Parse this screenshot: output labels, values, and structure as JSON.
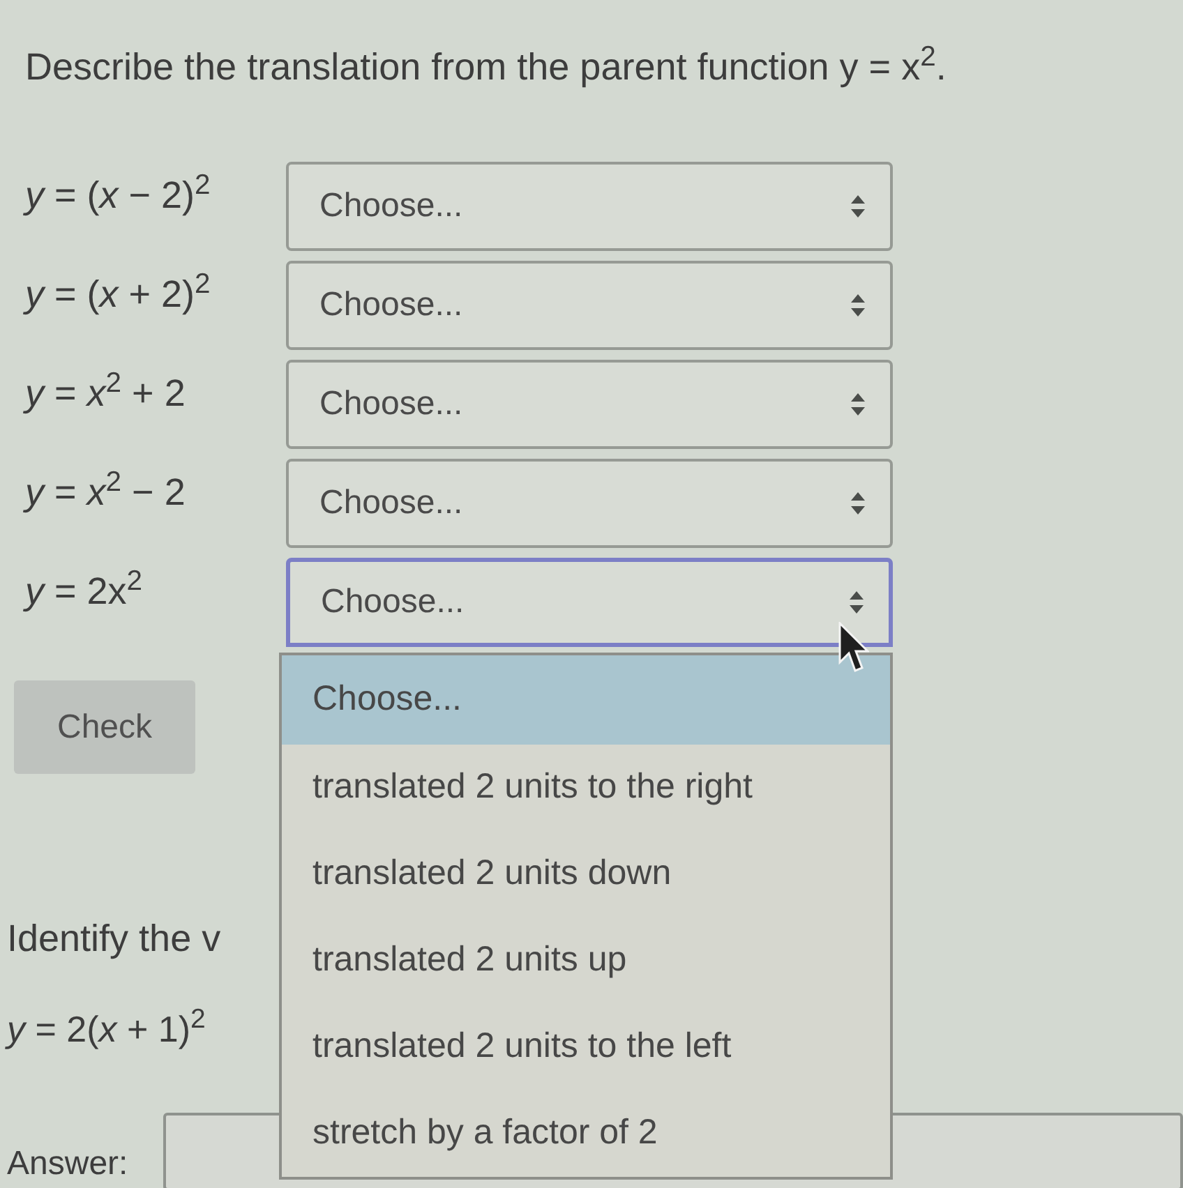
{
  "prompt": "Describe the translation from the parent function y = x$^{2}$.",
  "rows": [
    {
      "equation": "*y* = (*x* − 2)$^{2}$",
      "value": "Choose...",
      "focused": false,
      "expanded": false
    },
    {
      "equation": "*y* = (*x* + 2)$^{2}$",
      "value": "Choose...",
      "focused": false,
      "expanded": false
    },
    {
      "equation": "*y* = *x*$^{2}$ + 2",
      "value": "Choose...",
      "focused": false,
      "expanded": false
    },
    {
      "equation": "*y* = *x*$^{2}$ − 2",
      "value": "Choose...",
      "focused": false,
      "expanded": false
    },
    {
      "equation": "*y* = 2x$^{2}$",
      "value": "Choose...",
      "focused": true,
      "expanded": true
    }
  ],
  "check_button": "Check",
  "dropdown": {
    "options": [
      {
        "label": "Choose...",
        "selected": true
      },
      {
        "label": "translated 2 units to the right",
        "selected": false
      },
      {
        "label": "translated 2 units down",
        "selected": false
      },
      {
        "label": "translated 2 units up",
        "selected": false
      },
      {
        "label": "translated 2 units to the left",
        "selected": false
      },
      {
        "label": "stretch by a factor of 2",
        "selected": false
      }
    ]
  },
  "question2": {
    "prompt": "Identify the v",
    "equation": "*y* = 2(*x* + 1)$^{2}$",
    "answer_label": "Answer:"
  }
}
